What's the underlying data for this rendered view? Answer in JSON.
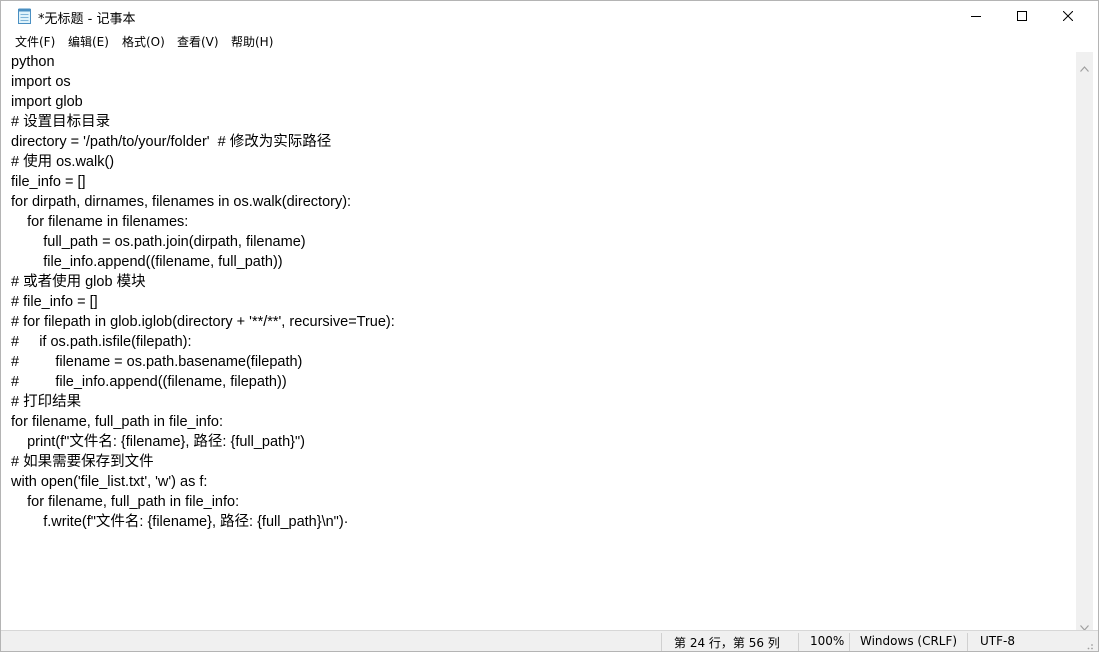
{
  "window": {
    "title": "*无标题 - 记事本"
  },
  "menu": {
    "items": [
      {
        "label": "文件(F)"
      },
      {
        "label": "编辑(E)"
      },
      {
        "label": "格式(O)"
      },
      {
        "label": "查看(V)"
      },
      {
        "label": "帮助(H)"
      }
    ]
  },
  "editor": {
    "lines": [
      "python",
      "import os",
      "import glob",
      "# 设置目标目录",
      "directory = '/path/to/your/folder'  # 修改为实际路径",
      "# 使用 os.walk()",
      "file_info = []",
      "for dirpath, dirnames, filenames in os.walk(directory):",
      "    for filename in filenames:",
      "        full_path = os.path.join(dirpath, filename)",
      "        file_info.append((filename, full_path))",
      "# 或者使用 glob 模块",
      "# file_info = []",
      "# for filepath in glob.iglob(directory + '**/**', recursive=True):",
      "#     if os.path.isfile(filepath):",
      "#         filename = os.path.basename(filepath)",
      "#         file_info.append((filename, filepath))",
      "# 打印结果",
      "for filename, full_path in file_info:",
      "    print(f\"文件名: {filename}, 路径: {full_path}\")",
      "# 如果需要保存到文件",
      "with open('file_list.txt', 'w') as f:",
      "    for filename, full_path in file_info:",
      "        f.write(f\"文件名: {filename}, 路径: {full_path}\\n\")·"
    ]
  },
  "status": {
    "position": "第 24 行，第 56 列",
    "zoom": "100%",
    "line_ending": "Windows (CRLF)",
    "encoding": "UTF-8"
  }
}
